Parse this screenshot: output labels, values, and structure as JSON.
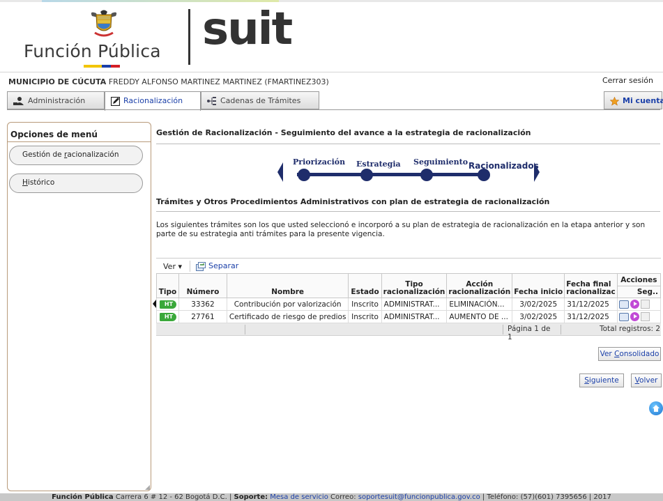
{
  "header": {
    "brand_text": "Función Pública",
    "product_text": "suit"
  },
  "user": {
    "entity": "MUNICIPIO DE CÚCUTA",
    "name": "FREDDY ALFONSO MARTINEZ MARTINEZ (FMARTINEZ303)",
    "logout_label": "Cerrar sesión"
  },
  "tabs": [
    {
      "label": "Administración",
      "icon": "user-admin-icon",
      "active": false
    },
    {
      "label": "Racionalización",
      "icon": "edit-icon",
      "active": true
    },
    {
      "label": "Cadenas de Trámites",
      "icon": "tree-icon",
      "active": false
    }
  ],
  "account_label": "Mi cuenta",
  "sidebar": {
    "title": "Opciones de menú",
    "items": [
      {
        "label_pre": "Gestión de ",
        "label_u": "r",
        "label_post": "acionalización"
      },
      {
        "label_pre": "",
        "label_u": "H",
        "label_post": "istórico"
      }
    ]
  },
  "main": {
    "title": "Gestión de Racionalización - Seguimiento del avance a la estrategia de racionalización",
    "steps": [
      "Priorización",
      "Estrategia",
      "Seguimiento",
      "Racionalizados"
    ],
    "section_title": "Trámites y Otros Procedimientos Administrativos con plan de estrategia de racionalización",
    "description": "Los siguientes trámites son los que usted seleccionó e incorporó a su plan de estrategia de racionalización en la etapa anterior y son parte de su estrategia anti trámites para la presente vigencia."
  },
  "grid": {
    "ver_label": "Ver ▾",
    "separar_label": "Separar",
    "headers": {
      "tipo": "Tipo",
      "numero": "Número",
      "nombre": "Nombre",
      "estado": "Estado",
      "tipo_rac_1": "Tipo",
      "tipo_rac_2": "racionalización",
      "accion_1": "Acción",
      "accion_2": "racionalización",
      "fecha_inicio": "Fecha inicio",
      "fecha_final_1": "Fecha final",
      "fecha_final_2": "racionalizac",
      "acciones": "Acciones",
      "seg": "Seg.."
    },
    "rows": [
      {
        "tipo": "HT",
        "numero": "33362",
        "nombre": "Contribución por valorización",
        "estado": "Inscrito",
        "tipo_rac": "ADMINISTRAT...",
        "accion": "ELIMINACIÓN...",
        "fecha_inicio": "3/02/2025",
        "fecha_final": "31/12/2025"
      },
      {
        "tipo": "HT",
        "numero": "27761",
        "nombre": "Certificado de riesgo de predios",
        "estado": "Inscrito",
        "tipo_rac": "ADMINISTRAT...",
        "accion": "AUMENTO DE ...",
        "fecha_inicio": "3/02/2025",
        "fecha_final": "31/12/2025"
      }
    ],
    "page_text": "Página 1 de 1",
    "total_text": "Total registros: 2"
  },
  "buttons": {
    "consolidado_pre": "Ver ",
    "consolidado_u": "C",
    "consolidado_post": "onsolidado",
    "siguiente_pre": "",
    "siguiente_u": "S",
    "siguiente_post": "iguiente",
    "volver_pre": "",
    "volver_u": "V",
    "volver_post": "olver"
  },
  "footer": {
    "brand": "Función Pública",
    "address": " Carrera 6 # 12 - 62 Bogotá D.C. | ",
    "support_label": "Soporte:",
    "support_link": " Mesa de servicio",
    "email_label": "   Correo: ",
    "email": "soportesuit@funcionpublica.gov.co",
    "phone": " | Teléfono: (57)(601) 7395656 | 2017"
  },
  "colors": {
    "accent": "#1a3fa8",
    "step_navy": "#1f2d6b",
    "badge_green": "#3aa83a",
    "sidebar_border": "#b89a7a"
  }
}
